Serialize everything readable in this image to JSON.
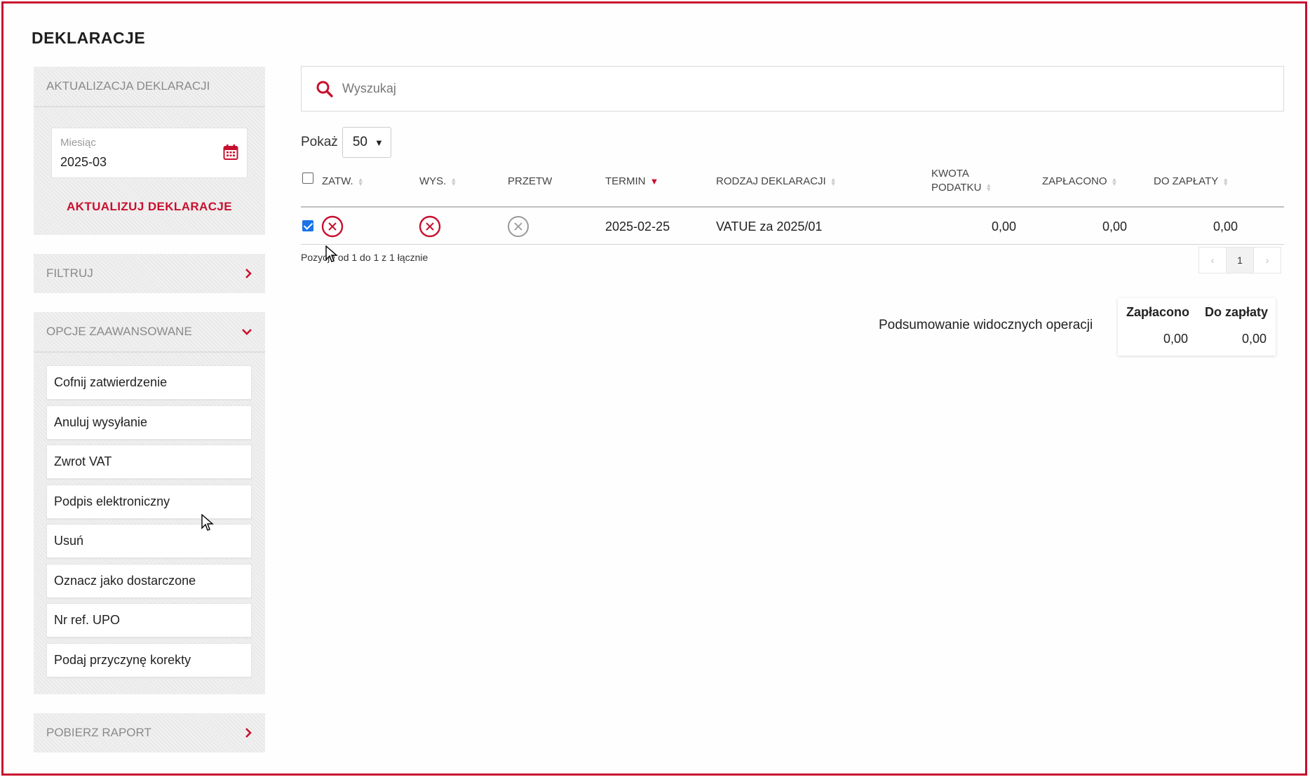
{
  "page": {
    "title": "DEKLARACJE"
  },
  "sidebar": {
    "update": {
      "header": "AKTUALIZACJA DEKLARACJI",
      "month_label": "Miesiąc",
      "month_value": "2025-03",
      "button": "AKTUALIZUJ DEKLARACJE"
    },
    "filter": {
      "header": "FILTRUJ"
    },
    "advanced": {
      "header": "OPCJE ZAAWANSOWANE",
      "items": [
        "Cofnij zatwierdzenie",
        "Anuluj wysyłanie",
        "Zwrot VAT",
        "Podpis elektroniczny",
        "Usuń",
        "Oznacz jako dostarczone",
        "Nr ref. UPO",
        "Podaj przyczynę korekty"
      ]
    },
    "report": {
      "header": "POBIERZ RAPORT"
    }
  },
  "search": {
    "placeholder": "Wyszukaj"
  },
  "table": {
    "show_label": "Pokaż",
    "page_size": "50",
    "columns": {
      "zatw": "ZATW.",
      "wys": "WYS.",
      "przetw": "PRZETW",
      "termin": "TERMIN",
      "rodzaj": "RODZAJ DEKLARACJI",
      "kwota_1": "KWOTA",
      "kwota_2": "PODATKU",
      "zaplacono": "ZAPŁACONO",
      "do_zaplaty": "DO ZAPŁATY"
    },
    "rows": [
      {
        "selected": true,
        "zatw": "rejected",
        "wys": "rejected",
        "przetw": "inactive",
        "termin": "2025-02-25",
        "rodzaj": "VATUE za 2025/01",
        "kwota": "0,00",
        "zaplacono": "0,00",
        "do_zaplaty": "0,00"
      }
    ],
    "info": "Pozycje od 1 do 1 z 1 łącznie",
    "pager": {
      "prev": "‹",
      "current": "1",
      "next": "›"
    }
  },
  "summary": {
    "label": "Podsumowanie widocznych operacji",
    "headers": {
      "zaplacono": "Zapłacono",
      "do_zaplaty": "Do zapłaty"
    },
    "values": {
      "zaplacono": "0,00",
      "do_zaplaty": "0,00"
    }
  },
  "colors": {
    "accent": "#c8102e",
    "checkbox": "#1a73e8"
  },
  "icons": {
    "calendar": "calendar-icon",
    "search": "search-icon",
    "chevron_right": "chevron-right-icon",
    "chevron_down": "chevron-down-icon",
    "status_rejected": "x-circle-icon",
    "status_inactive": "x-circle-gray-icon"
  }
}
